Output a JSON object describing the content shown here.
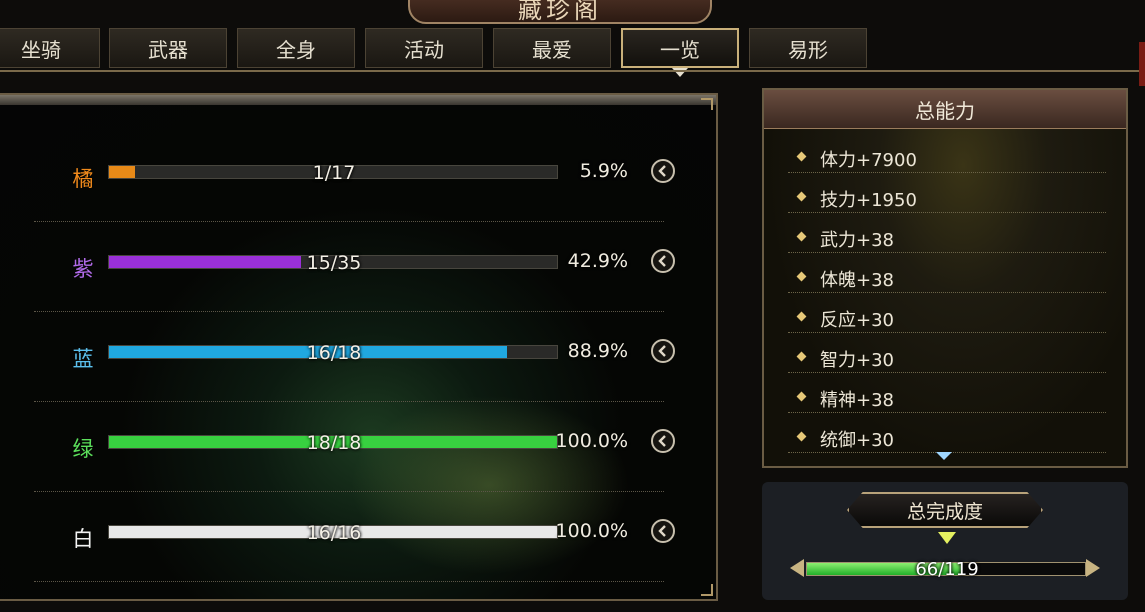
{
  "title": "藏珍阁",
  "tabs": [
    {
      "label": "坐骑",
      "active": false
    },
    {
      "label": "武器",
      "active": false
    },
    {
      "label": "全身",
      "active": false
    },
    {
      "label": "活动",
      "active": false
    },
    {
      "label": "最爱",
      "active": false
    },
    {
      "label": "一览",
      "active": true
    },
    {
      "label": "易形",
      "active": false
    }
  ],
  "rarities": [
    {
      "label": "橘",
      "color": "#f08a1c",
      "fill_color": "#e88a18",
      "count": "1/17",
      "collected": 1,
      "total": 17,
      "percent": "5.9%"
    },
    {
      "label": "紫",
      "color": "#b06ae8",
      "fill_color": "#9a30d8",
      "count": "15/35",
      "collected": 15,
      "total": 35,
      "percent": "42.9%"
    },
    {
      "label": "蓝",
      "color": "#5cc0ee",
      "fill_color": "#20a8e0",
      "count": "16/18",
      "collected": 16,
      "total": 18,
      "percent": "88.9%"
    },
    {
      "label": "绿",
      "color": "#5ce05c",
      "fill_color": "#38d040",
      "count": "18/18",
      "collected": 18,
      "total": 18,
      "percent": "100.0%"
    },
    {
      "label": "白",
      "color": "#f4f4f4",
      "fill_color": "#e8e8e8",
      "count": "16/16",
      "collected": 16,
      "total": 16,
      "percent": "100.0%"
    }
  ],
  "total_ability": {
    "header": "总能力",
    "stats": [
      "体力+7900",
      "技力+1950",
      "武力+38",
      "体魄+38",
      "反应+30",
      "智力+30",
      "精神+38",
      "统御+30"
    ]
  },
  "completion": {
    "title": "总完成度",
    "count": "66/119",
    "collected": 66,
    "total": 119
  },
  "icons": {
    "row_button": "chevron-left-icon"
  }
}
